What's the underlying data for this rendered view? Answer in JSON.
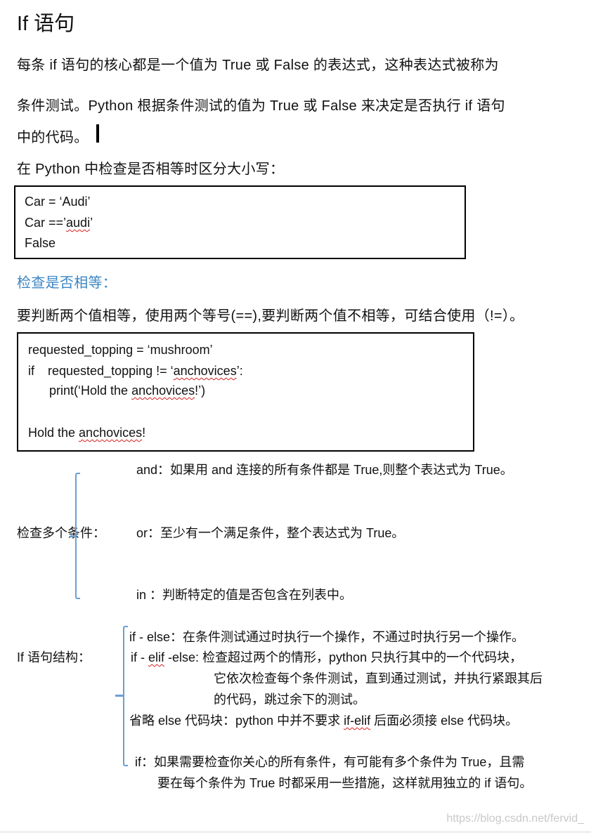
{
  "title": "If  语句",
  "intro": {
    "line1": "每条 if  语句的核心都是一个值为 True  或  False  的表达式，这种表达式被称为",
    "line2": "条件测试。Python 根据条件测试的值为 True  或  False  来决定是否执行 if  语句",
    "line3": "中的代码。"
  },
  "case_note": "在 Python 中检查是否相等时区分大小写：",
  "code_box_1": {
    "line1": "Car = ‘Audi’",
    "line2_pre": "Car ==’",
    "line2_squig": "audi",
    "line2_post": "’",
    "line3": "False"
  },
  "equality_heading": "检查是否相等：",
  "equality_text": "要判断两个值相等，使用两个等号(==),要判断两个值不相等，可结合使用（!=）。",
  "code_box_2": {
    "line1": "requested_topping = ‘mushroom’",
    "line2_kw": "if",
    "line2_pre": "requested_topping != ‘",
    "line2_squig": "anchovices",
    "line2_post": "’:",
    "line3_pre": "print(‘Hold the ",
    "line3_squig": "anchovices",
    "line3_post": "!’)",
    "output_pre": "Hold the ",
    "output_squig": "anchovices",
    "output_post": "!"
  },
  "multi_conditions": {
    "label": "检查多个条件：",
    "items": [
      "and：如果用 and  连接的所有条件都是  True,则整个表达式为 True。",
      "or：至少有一个满足条件，整个表达式为 True。",
      "in  ：判断特定的值是否包含在列表中。"
    ]
  },
  "if_structure": {
    "label": "If  语句结构：",
    "if_else": "if - else：在条件测试通过时执行一个操作，不通过时执行另一个操作。",
    "elif_pre": "if - ",
    "elif_squig": "elif",
    "elif_post": " -else:  检查超过两个的情形，python 只执行其中的一个代码块，",
    "elif_line2": "它依次检查每个条件测试，直到通过测试，并执行紧跟其后",
    "elif_line3": "的代码，跳过余下的测试。",
    "omit_pre": "省略 else 代码块：python 中并不要求 ",
    "omit_squig": "if-elif",
    "omit_post": " 后面必须接 else 代码块。",
    "if_line1": "if：如果需要检查你关心的所有条件，有可能有多个条件为 True，且需",
    "if_line2": "要在每个条件为 True 时都采用一些措施，这样就用独立的 if  语句。"
  },
  "watermark": "https://blog.csdn.net/fervid_",
  "colors": {
    "heading_blue": "#3b86c4",
    "brace_blue": "#6b9fd3",
    "spellcheck_red": "#d42020"
  }
}
